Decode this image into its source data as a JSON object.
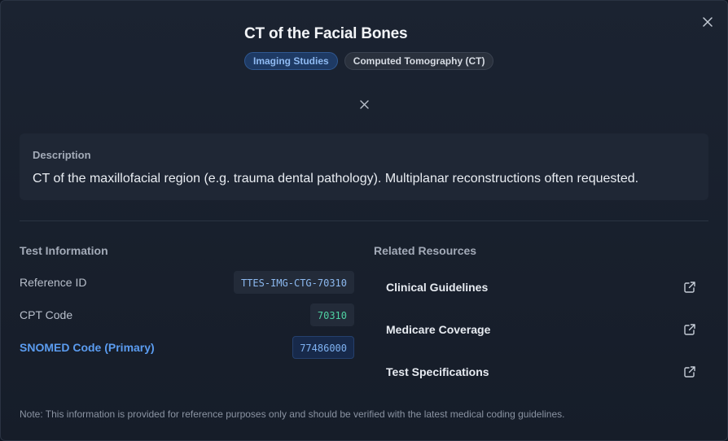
{
  "header": {
    "title": "CT of the Facial Bones",
    "badges": [
      "Imaging Studies",
      "Computed Tomography (CT)"
    ]
  },
  "description": {
    "label": "Description",
    "text": "CT of the maxillofacial region (e.g. trauma dental pathology). Multiplanar reconstructions often requested."
  },
  "test_info": {
    "title": "Test Information",
    "rows": [
      {
        "label": "Reference ID",
        "value": "TTES-IMG-CTG-70310"
      },
      {
        "label": "CPT Code",
        "value": "70310"
      },
      {
        "label": "SNOMED Code (Primary)",
        "value": "77486000"
      }
    ]
  },
  "resources": {
    "title": "Related Resources",
    "items": [
      {
        "label": "Clinical Guidelines",
        "icon": "external-link-icon"
      },
      {
        "label": "Medicare Coverage",
        "icon": "external-link-icon"
      },
      {
        "label": "Test Specifications",
        "icon": "external-link-icon"
      }
    ]
  },
  "note": "Note: This information is provided for reference purposes only and should be verified with the latest medical coding guidelines.",
  "icons": {
    "close": "close-icon"
  },
  "colors": {
    "accent": "#5b9cf0",
    "code_green": "#4fd1a2",
    "badge_primary_bg": "#1e3a64",
    "background": "#1b2331"
  }
}
